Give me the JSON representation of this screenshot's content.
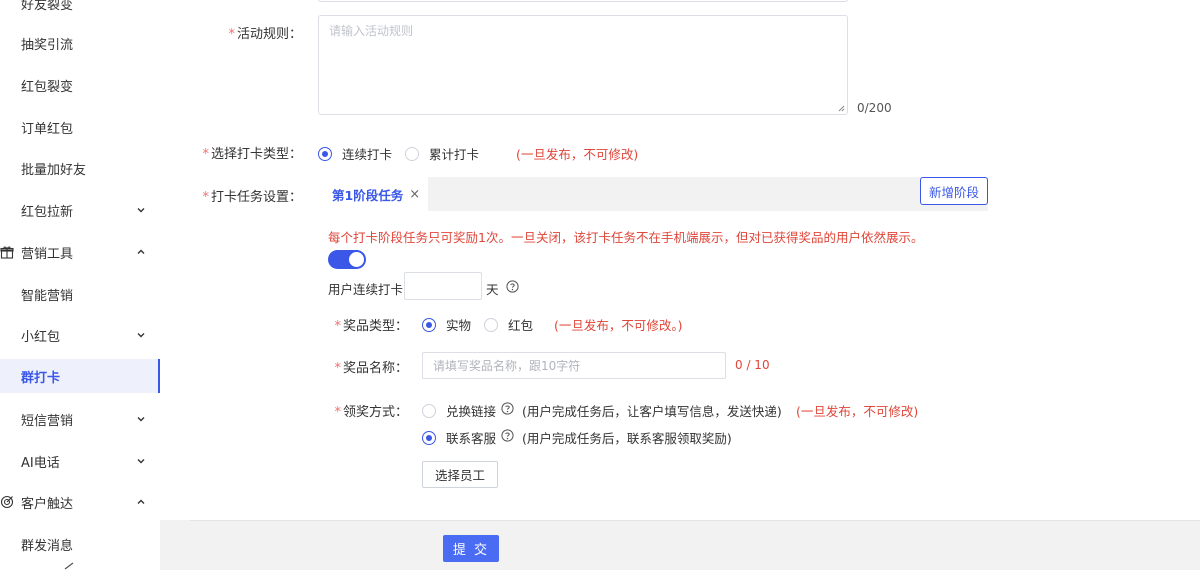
{
  "sidebar": {
    "items": [
      {
        "label": "好友裂变",
        "has_chevron": false
      },
      {
        "label": "抽奖引流",
        "has_chevron": false
      },
      {
        "label": "红包裂变",
        "has_chevron": false
      },
      {
        "label": "订单红包",
        "has_chevron": false
      },
      {
        "label": "批量加好友",
        "has_chevron": false
      },
      {
        "label": "红包拉新",
        "has_chevron": true
      }
    ],
    "group_marketing": {
      "label": "营销工具",
      "icon": "gift-icon",
      "expanded": true
    },
    "marketing_items": [
      {
        "label": "智能营销",
        "has_chevron": false
      },
      {
        "label": "小红包",
        "has_chevron": true
      },
      {
        "label": "群打卡",
        "active": true
      },
      {
        "label": "短信营销",
        "has_chevron": true
      },
      {
        "label": "AI电话",
        "has_chevron": true
      }
    ],
    "group_reach": {
      "label": "客户触达",
      "icon": "target-icon",
      "expanded": true
    },
    "reach_items": [
      {
        "label": "群发消息"
      }
    ]
  },
  "form": {
    "rules": {
      "label": "活动规则：",
      "placeholder": "请输入活动规则",
      "counter": "0/200"
    },
    "checkin_type": {
      "label": "选择打卡类型：",
      "options": [
        "连续打卡",
        "累计打卡"
      ],
      "selected": "连续打卡",
      "warning": "(一旦发布，不可修改)"
    },
    "task_settings": {
      "label": "打卡任务设置：",
      "tab_label": "第1阶段任务",
      "add_stage_label": "新增阶段",
      "notice": "每个打卡阶段任务只可奖励1次。一旦关闭，该打卡任务不在手机端展示，但对已获得奖品的用户依然展示。",
      "toggle_on": true,
      "days_prefix": "用户连续打卡",
      "days_suffix": "天",
      "prize_type": {
        "label": "奖品类型：",
        "options": [
          "实物",
          "红包"
        ],
        "selected": "实物",
        "warning": "(一旦发布，不可修改。)"
      },
      "prize_name": {
        "label": "奖品名称：",
        "placeholder": "请填写奖品名称，跟10字符",
        "counter": "0 / 10"
      },
      "claim_method": {
        "label": "领奖方式：",
        "option_exchange": "兑换链接",
        "option_exchange_note": "(用户完成任务后，让客户填写信息，发送快递)",
        "option_exchange_warning": "(一旦发布，不可修改)",
        "option_service": "联系客服",
        "option_service_note": "(用户完成任务后，联系客服领取奖励)",
        "selected": "联系客服",
        "select_staff_label": "选择员工"
      }
    }
  },
  "footer": {
    "submit_label": "提 交"
  },
  "colors": {
    "accent": "#3a57e8",
    "warning": "#e0463a",
    "required": "#f56c6c"
  }
}
